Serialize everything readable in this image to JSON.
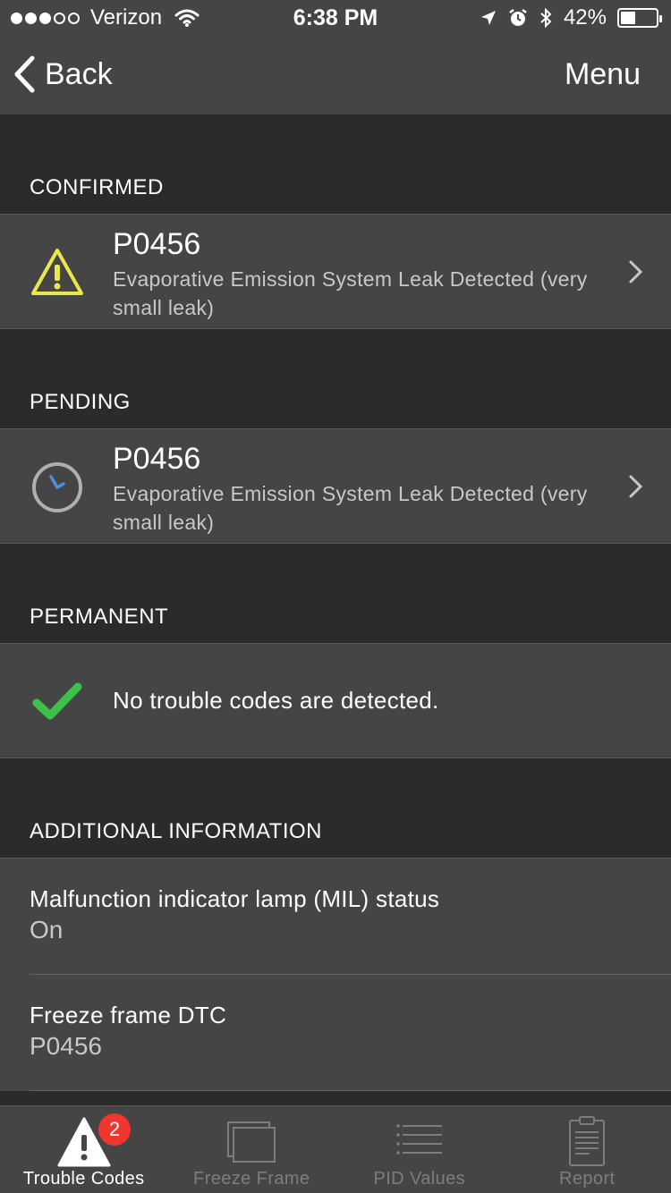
{
  "status_bar": {
    "carrier": "Verizon",
    "time": "6:38 PM",
    "battery": "42%",
    "battery_level": 0.42,
    "signal_dots_filled": 3,
    "signal_dots_total": 5
  },
  "nav": {
    "back_label": "Back",
    "menu_label": "Menu"
  },
  "sections": {
    "confirmed": {
      "title": "CONFIRMED",
      "code": "P0456",
      "description": "Evaporative Emission System Leak Detected (very small leak)",
      "icon": "warning-icon"
    },
    "pending": {
      "title": "PENDING",
      "code": "P0456",
      "description": "Evaporative Emission System Leak Detected (very small leak)",
      "icon": "clock-icon"
    },
    "permanent": {
      "title": "PERMANENT",
      "message": "No trouble codes are detected.",
      "icon": "checkmark-icon"
    },
    "additional": {
      "title": "ADDITIONAL INFORMATION",
      "items": [
        {
          "label": "Malfunction indicator lamp (MIL) status",
          "value": "On"
        },
        {
          "label": "Freeze frame DTC",
          "value": "P0456"
        }
      ]
    }
  },
  "tabbar": {
    "tabs": [
      {
        "label": "Trouble Codes",
        "icon": "warning-icon",
        "badge": "2",
        "active": true
      },
      {
        "label": "Freeze Frame",
        "icon": "freeze-frame-icon",
        "active": false
      },
      {
        "label": "PID Values",
        "icon": "list-icon",
        "active": false
      },
      {
        "label": "Report",
        "icon": "clipboard-icon",
        "active": false
      }
    ]
  },
  "colors": {
    "background": "#2b2b2b",
    "row_background": "#454545",
    "warning_yellow": "#e8e84a",
    "clock_hand_blue": "#4a90e2",
    "check_green": "#3cc24a",
    "badge_red": "#f0362f"
  }
}
